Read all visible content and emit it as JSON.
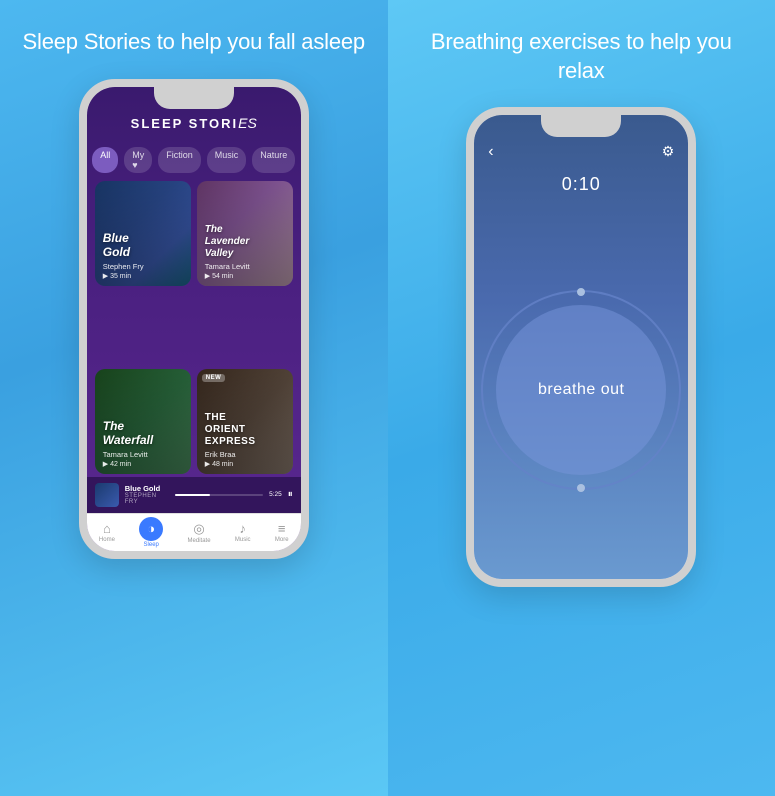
{
  "left_panel": {
    "title": "Sleep Stories to help you fall asleep",
    "phone": {
      "header": {
        "title_main": "SLEEP STORI",
        "title_cursive": "es"
      },
      "filters": [
        {
          "label": "All",
          "active": true
        },
        {
          "label": "My ♥",
          "active": false
        },
        {
          "label": "Fiction",
          "active": false
        },
        {
          "label": "Music",
          "active": false
        },
        {
          "label": "Nature",
          "active": false
        }
      ],
      "stories": [
        {
          "title": "Blue\nGold",
          "author": "Stephen Fry",
          "duration": "▶ 35 min",
          "bg": "blue-gold",
          "new": false
        },
        {
          "title": "The\nLavender\nValley",
          "author": "Tamara Levitt",
          "duration": "▶ 54 min",
          "bg": "lavender",
          "new": false
        },
        {
          "title": "The\nWaterfall",
          "author": "Tamara Levitt",
          "duration": "▶ 42 min",
          "bg": "waterfall",
          "new": false
        },
        {
          "title": "THE\nORIENT\nEXPRESS",
          "author": "Erik Braa",
          "duration": "▶ 48 min",
          "bg": "orient",
          "new": true,
          "new_label": "NEW"
        }
      ],
      "now_playing": {
        "title": "Blue Gold",
        "author": "STEPHEN FRY",
        "time": "5:25"
      },
      "nav": [
        {
          "label": "Home",
          "icon": "⌂",
          "active": false
        },
        {
          "label": "Sleep",
          "icon": "◑",
          "active": true
        },
        {
          "label": "Meditate",
          "icon": "◎",
          "active": false
        },
        {
          "label": "Music",
          "icon": "♪",
          "active": false
        },
        {
          "label": "More",
          "icon": "≡",
          "active": false
        }
      ]
    }
  },
  "right_panel": {
    "title": "Breathing exercises to help you relax",
    "phone": {
      "timer": "0:10",
      "breathe_text": "breathe out",
      "back_icon": "‹",
      "settings_icon": "⚙"
    }
  }
}
